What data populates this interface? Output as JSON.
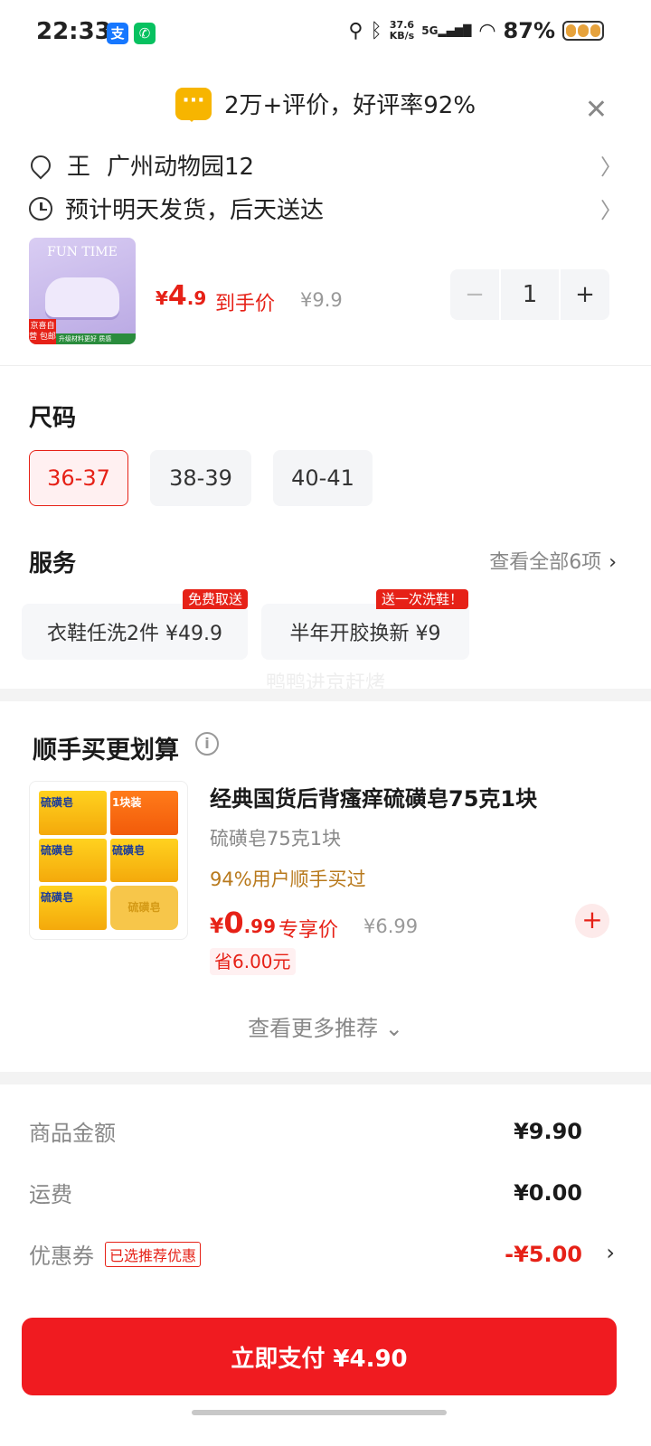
{
  "status_bar": {
    "time": "22:33",
    "app_badges": [
      "支",
      "✆"
    ],
    "net_speed_value": "37.6",
    "net_speed_unit": "KB/s",
    "network": "5G",
    "battery": "87%"
  },
  "rating": {
    "text": "2万+评价，好评率92%"
  },
  "address": {
    "name": "王",
    "location": "广州动物园12"
  },
  "delivery": {
    "text": "预计明天发货，后天送达"
  },
  "product": {
    "thumb_caption": "FUN TIME",
    "thumb_tag": "京喜自营 包邮",
    "thumb_strip": "升级材料更好 质感",
    "price_currency": "¥",
    "price_int": "4",
    "price_dec": ".9",
    "price_label": "到手价",
    "original_price": "¥9.9",
    "quantity": "1",
    "minus": "−",
    "plus": "+"
  },
  "size": {
    "title": "尺码",
    "options": [
      "36-37",
      "38-39",
      "40-41"
    ],
    "selected": "36-37"
  },
  "service": {
    "title": "服务",
    "see_all": "查看全部6项",
    "chevron": "›",
    "items": [
      {
        "label": "衣鞋任洗2件  ¥49.9",
        "badge": "免费取送"
      },
      {
        "label": "半年开胶换新  ¥9",
        "badge": "送一次洗鞋！"
      }
    ]
  },
  "watermark": "鸭鸭进京赶烤",
  "upsell": {
    "title": "顺手买更划算",
    "info": "i",
    "product": {
      "name": "经典国货后背瘙痒硫磺皂75克1块",
      "spec": "硫磺皂75克1块",
      "popularity": "94%用户顺手买过",
      "price_currency": "¥",
      "price_int": "0",
      "price_dec": ".99",
      "price_label": "专享价",
      "original_price": "¥6.99",
      "save": "省6.00元",
      "image_labels": [
        "硫磺皂",
        "1块装",
        "硫磺皂"
      ],
      "add": "+"
    },
    "more": "查看更多推荐 ⌄"
  },
  "summary": {
    "goods_label": "商品金额",
    "goods_value": "¥9.90",
    "shipping_label": "运费",
    "shipping_value": "¥0.00",
    "coupon_label": "优惠券",
    "coupon_tag": "已选推荐优惠",
    "coupon_value": "-¥5.00",
    "coupon_arrow": "›"
  },
  "pay_button": "立即支付 ¥4.90",
  "colors": {
    "accent": "#e62117",
    "pay_button": "#f01b20",
    "rating_icon": "#f7b500",
    "popularity_text": "#b8791c"
  }
}
